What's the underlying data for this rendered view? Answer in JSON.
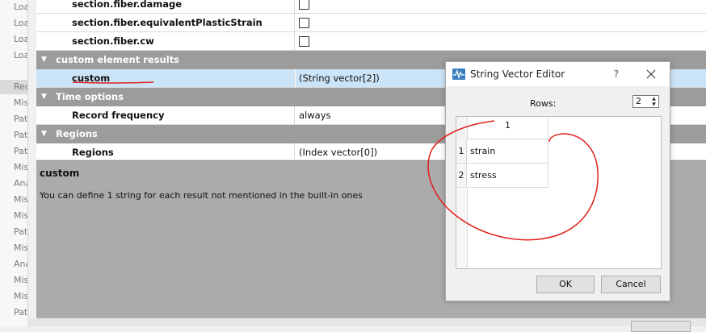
{
  "left_tree": {
    "items": [
      "Loa",
      "Loa",
      "Loa",
      "Loa",
      "Rec",
      "Mis",
      "Pat",
      "Pat",
      "Pat",
      "Mis",
      "Ana",
      "Mis",
      "Mis",
      "Pat",
      "Mis",
      "Ana",
      "Mis",
      "Mis",
      "Pat"
    ]
  },
  "property_grid": {
    "rows": [
      {
        "name": "section.fiber.damage",
        "type": "checkbox"
      },
      {
        "name": "section.fiber.equivalentPlasticStrain",
        "type": "checkbox"
      },
      {
        "name": "section.fiber.cw",
        "type": "checkbox"
      }
    ],
    "category_custom": "custom element results",
    "custom_row": {
      "name": "custom",
      "value": "(String vector[2])"
    },
    "category_time": "Time options",
    "record_frequency": {
      "name": "Record frequency",
      "value": "always"
    },
    "category_regions": "Regions",
    "regions_row": {
      "name": "Regions",
      "value": "(Index vector[0])"
    }
  },
  "description": {
    "title": "custom",
    "text": "You can define 1 string for each result not mentioned in the built-in ones"
  },
  "dialog": {
    "title": "String Vector Editor",
    "help": "?",
    "rows_label": "Rows:",
    "rows_value": "2",
    "column_header": "1",
    "table": [
      {
        "row": "1",
        "value": "strain"
      },
      {
        "row": "2",
        "value": "stress"
      }
    ],
    "ok_label": "OK",
    "cancel_label": "Cancel"
  },
  "colors": {
    "category_bg": "#9c9c9c",
    "selection": "#cce4f7",
    "annotation": "#e0201a",
    "description_bg": "#ababab"
  }
}
